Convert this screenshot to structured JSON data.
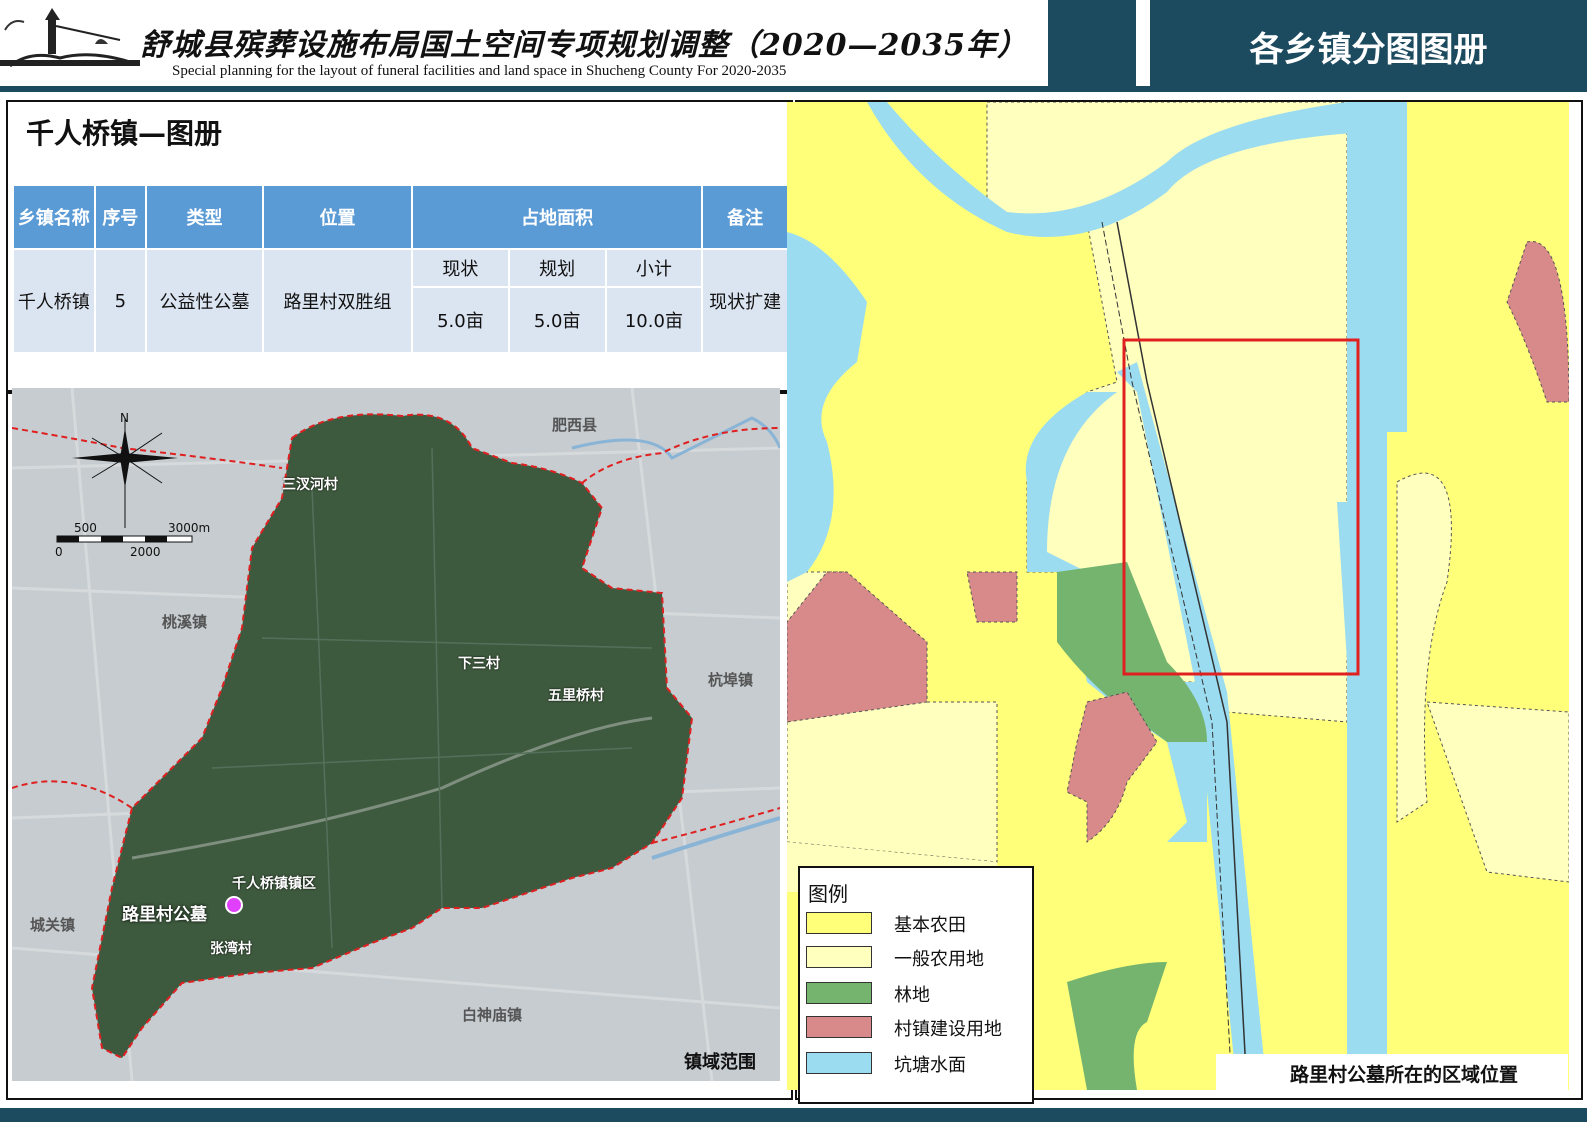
{
  "header": {
    "title": "舒城县殡葬设施布局国土空间专项规划调整（2020—2035年）",
    "subtitle": "Special planning for the layout of funeral facilities and land space in Shucheng County For 2020-2035",
    "section": "各乡镇分图图册"
  },
  "town_title": "千人桥镇—图册",
  "table": {
    "headers": {
      "town": "乡镇名称",
      "seq": "序号",
      "type": "类型",
      "location": "位置",
      "area": "占地面积",
      "note": "备注",
      "current": "现状",
      "planned": "规划",
      "subtotal": "小计"
    },
    "row": {
      "town": "千人桥镇",
      "seq": "5",
      "type": "公益性公墓",
      "location": "路里村双胜组",
      "current": "5.0亩",
      "planned": "5.0亩",
      "subtotal": "10.0亩",
      "note": "现状扩建"
    }
  },
  "left_map": {
    "north": "N",
    "scale_top": [
      "500",
      "3000m"
    ],
    "scale_bottom": [
      "0",
      "2000"
    ],
    "labels": {
      "feixi": "肥西县",
      "sanchahe": "三汊河村",
      "taoxi": "桃溪镇",
      "xiasan": "下三村",
      "wuliqiao": "五里桥村",
      "hangbu": "杭埠镇",
      "qianrenqiao": "千人桥镇镇区",
      "luli": "路里村公墓",
      "chengguan": "城关镇",
      "zhangwan": "张湾村",
      "baishenmiao": "白神庙镇"
    },
    "caption": "镇域范围"
  },
  "right_map": {
    "caption": "路里村公墓所在的区域位置",
    "legend_title": "图例",
    "legend": [
      {
        "label": "基本农田",
        "color": "#ffff7a"
      },
      {
        "label": "一般农用地",
        "color": "#ffffbe"
      },
      {
        "label": "林地",
        "color": "#74b46f"
      },
      {
        "label": "村镇建设用地",
        "color": "#d88a8a"
      },
      {
        "label": "坑塘水面",
        "color": "#9bdcf0"
      }
    ]
  },
  "colors": {
    "header_bg": "#1c4a5f",
    "table_header": "#5b9bd5",
    "table_body": "#dbe4f1",
    "boundary": "#e02020",
    "cemetery_marker": "#e040fb"
  }
}
